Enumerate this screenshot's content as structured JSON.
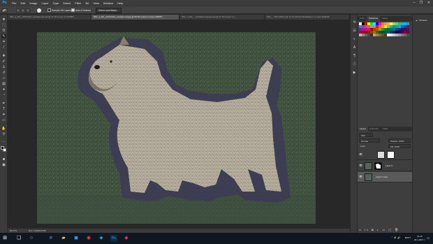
{
  "app": {
    "logo": "Ps",
    "menu": [
      "File",
      "Edit",
      "Image",
      "Layer",
      "Type",
      "Select",
      "Filter",
      "3D",
      "View",
      "Window",
      "Help"
    ],
    "window_controls": [
      "–",
      "❐",
      "✕"
    ]
  },
  "options_bar": {
    "sample_all_layers": "Sample All Layers",
    "auto_enhance": "Auto-Enhance",
    "select_and_mask": "Select and Mask..."
  },
  "document_tabs": [
    {
      "label": "IMG_1_DG_mhhhfekhn_background.psd @ 11.1% (Layer 0, RGB/8*)",
      "active": false
    },
    {
      "label": "IMG_1_DG_mhhhfekhn_background.jpg @ 66.6% (Layer 0 copy, RGB/8*)",
      "active": true
    },
    {
      "label": "IMG_1_DG_... (Untitled-cropped.psd @ 11.1% (Layer 0...)",
      "active": false
    },
    {
      "label": "IMG_... (PhotoShop @ 11.1% (Photo/Inhabitation: 1, Layer Mask/8)",
      "active": false
    }
  ],
  "status_bar": {
    "zoom": "66.67%",
    "doc_size": "Doc: 3.00M/10.4M"
  },
  "panels": {
    "color_tabs": [
      "Color",
      "Swatches",
      "Styles"
    ],
    "libraries_label": "Libraries",
    "layers_tabs": [
      "Layers",
      "Channels",
      "Paths"
    ],
    "kind_label": "Kind",
    "blend_mode": "Normal",
    "opacity": "Opacity: 100%",
    "lock_label": "Lock:",
    "fill": "Fill: 100%",
    "layers": [
      {
        "name": "",
        "selected": false
      },
      {
        "name": "Layer 0",
        "selected": false
      },
      {
        "name": "Layer 0 copy",
        "selected": true
      }
    ]
  },
  "taskbar": {
    "time": "21:26",
    "date": "24.1.2017 г.",
    "lang": "BGPT"
  },
  "swatch_colors": [
    "#ffffff",
    "#000000",
    "#ff0000",
    "#ffff00",
    "#00ff00",
    "#00ffff",
    "#0000ff",
    "#ff00ff",
    "#f26c4f",
    "#f68e55",
    "#fbaf5c",
    "#fff467",
    "#acd372",
    "#7cc576",
    "#3bb878",
    "#1abbb4",
    "#00bff3",
    "#438ccb",
    "#5574b9",
    "#605ca8",
    "#855fa8",
    "#a763a8",
    "#f06eaa",
    "#f26d7d",
    "#ed1c24",
    "#f26522",
    "#f7941d",
    "#fff200",
    "#8dc73f",
    "#39b54a",
    "#00a651",
    "#00a99d",
    "#00aeef",
    "#0072bc",
    "#0054a6",
    "#2e3192",
    "#662d91",
    "#92278f",
    "#ec008c",
    "#ed145b",
    "#9e0b0f",
    "#a0410d",
    "#a3620a",
    "#aba000",
    "#598527",
    "#197b30",
    "#007236",
    "#00746b",
    "#0076a3",
    "#004b80",
    "#003471",
    "#1b1464",
    "#440e62",
    "#630460",
    "#9e005d",
    "#9e0039",
    "#790000",
    "#7b2e00",
    "#7d4900",
    "#827b00",
    "#406618",
    "#005e20",
    "#005826",
    "#005952",
    "#005b7f",
    "#003663",
    "#002157",
    "#0d004c",
    "#32004b",
    "#4b0049",
    "#7b0046",
    "#7a0026",
    "#c7b299",
    "#998675",
    "#736357",
    "#534741",
    "#37302d",
    "#c69c6d",
    "#a67c52",
    "#8c6239",
    "#754c24",
    "#603913",
    "#ffffff",
    "#e6e6e6",
    "#cccccc",
    "#b3b3b3",
    "#999999",
    "#808080",
    "#666666",
    "#4d4d4d"
  ]
}
